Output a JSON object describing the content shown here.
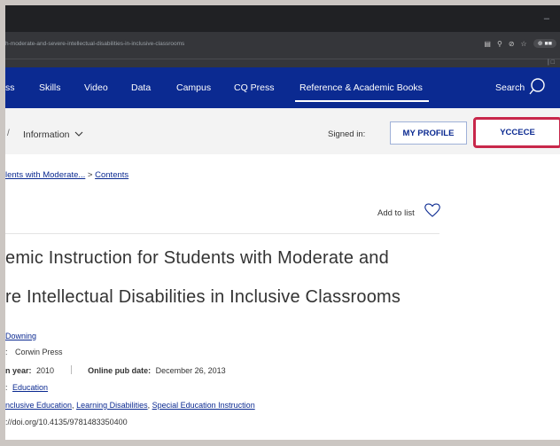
{
  "browser": {
    "url": "h-moderate-and-severe-intellectual-disabilities-in-inclusive-classrooms",
    "minimize_glyph": "–",
    "ext_badge": "⊕ ■■",
    "bookmark_glyph": "| □"
  },
  "nav": {
    "items": [
      "ss",
      "Skills",
      "Video",
      "Data",
      "Campus",
      "CQ Press",
      "Reference & Academic Books"
    ],
    "search_label": "Search"
  },
  "subnav": {
    "dash": "/",
    "information": "Information",
    "signed_in": "Signed in:",
    "profile_button": "MY PROFILE",
    "institution_button": "YCCECE"
  },
  "breadcrumb": {
    "link": "lents with Moderate...",
    "sep": " > ",
    "current": "Contents"
  },
  "add_to_list": "Add to list",
  "book": {
    "title_line1": "emic Instruction for Students with Moderate and",
    "title_line2": "re Intellectual Disabilities in Inclusive Classrooms",
    "author": "Downing",
    "publisher_prefix": ":",
    "publisher": "Corwin Press",
    "year_label": "n year:",
    "year": "2010",
    "online_label": "Online pub date:",
    "online_date": "December 26, 2013",
    "subject_prefix": ":",
    "subject": "Education",
    "keywords_prefix": "",
    "keywords": [
      "nclusive Education",
      "Learning Disabilities",
      "Special Education Instruction"
    ],
    "doi": "://doi.org/10.4135/9781483350400"
  },
  "colors": {
    "nav_bg": "#0b2a91",
    "highlight_border": "#c8274a"
  }
}
